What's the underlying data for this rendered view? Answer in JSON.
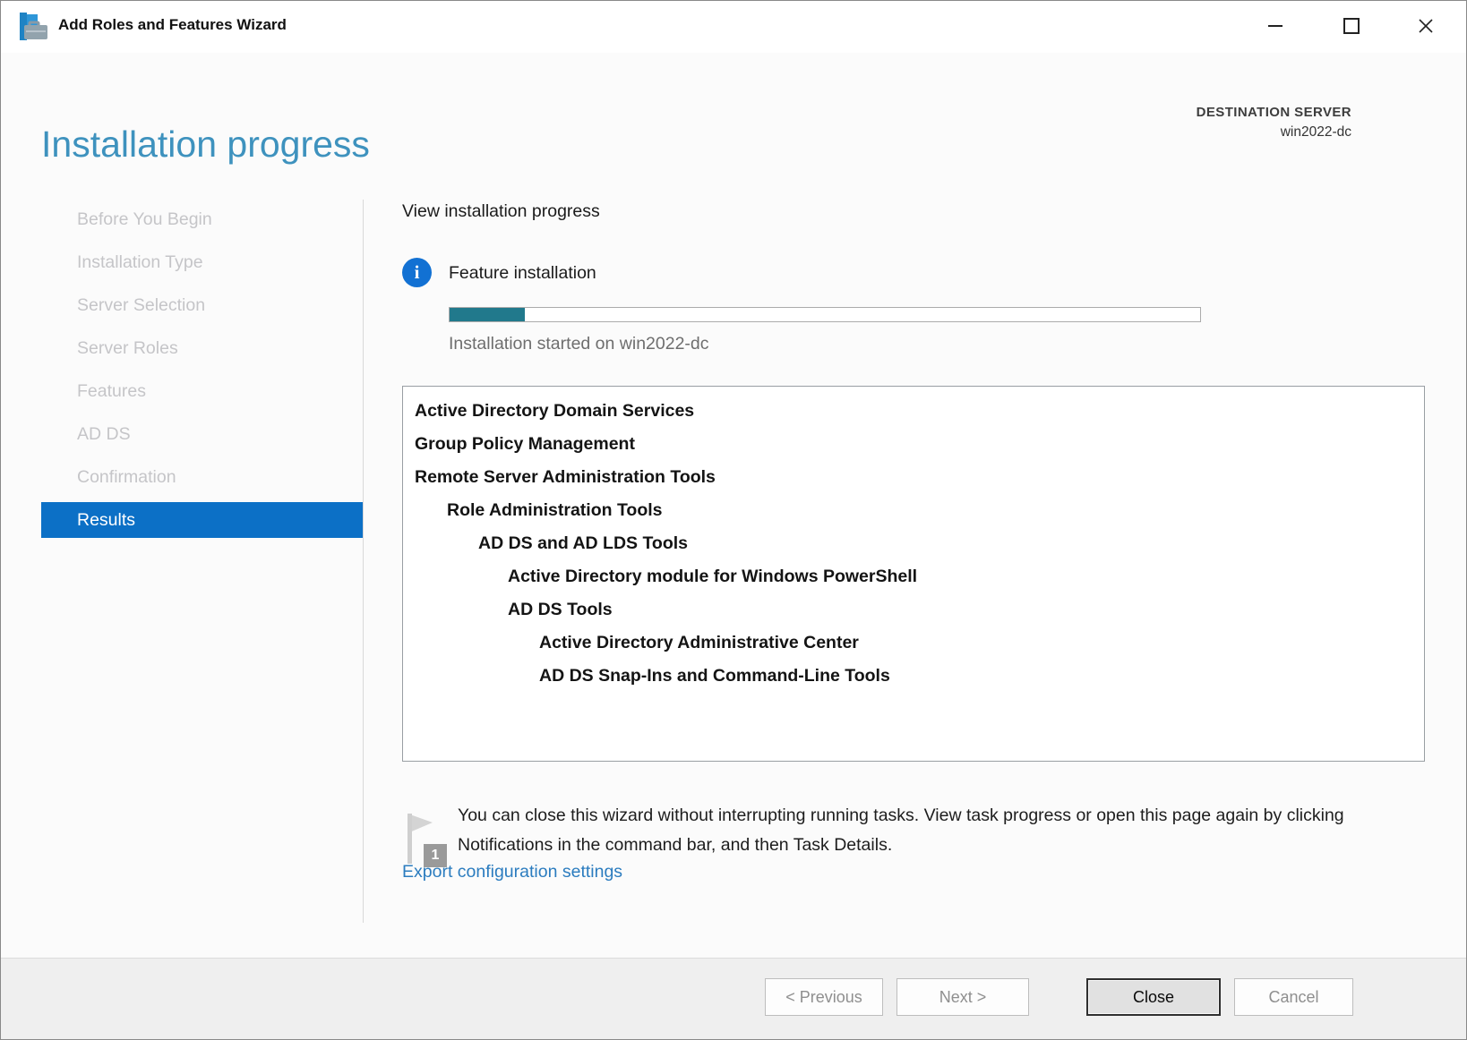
{
  "window": {
    "title": "Add Roles and Features Wizard",
    "controls": [
      "minimize",
      "maximize",
      "close"
    ]
  },
  "header": {
    "title": "Installation progress",
    "destination_label": "DESTINATION SERVER",
    "destination_server": "win2022-dc"
  },
  "sidebar": {
    "items": [
      {
        "label": "Before You Begin",
        "state": "disabled"
      },
      {
        "label": "Installation Type",
        "state": "disabled"
      },
      {
        "label": "Server Selection",
        "state": "disabled"
      },
      {
        "label": "Server Roles",
        "state": "disabled"
      },
      {
        "label": "Features",
        "state": "disabled"
      },
      {
        "label": "AD DS",
        "state": "disabled"
      },
      {
        "label": "Confirmation",
        "state": "disabled"
      },
      {
        "label": "Results",
        "state": "selected"
      }
    ]
  },
  "main": {
    "section_title": "View installation progress",
    "status": {
      "icon": "info-circle-icon",
      "title": "Feature installation",
      "progress_percent": 10,
      "detail": "Installation started on win2022-dc"
    },
    "features": [
      {
        "label": "Active Directory Domain Services",
        "indent": 0
      },
      {
        "label": "Group Policy Management",
        "indent": 0
      },
      {
        "label": "Remote Server Administration Tools",
        "indent": 0
      },
      {
        "label": "Role Administration Tools",
        "indent": 1
      },
      {
        "label": "AD DS and AD LDS Tools",
        "indent": 2
      },
      {
        "label": "Active Directory module for Windows PowerShell",
        "indent": 3
      },
      {
        "label": "AD DS Tools",
        "indent": 3
      },
      {
        "label": "Active Directory Administrative Center",
        "indent": 4
      },
      {
        "label": "AD DS Snap-Ins and Command-Line Tools",
        "indent": 4
      }
    ],
    "note": {
      "icon": "notification-flag-icon",
      "badge": "1",
      "text": "You can close this wizard without interrupting running tasks. View task progress or open this page again by clicking Notifications in the command bar, and then Task Details."
    },
    "export_link": "Export configuration settings"
  },
  "footer": {
    "buttons": [
      {
        "label": "< Previous",
        "state": "disabled"
      },
      {
        "label": "Next >",
        "state": "disabled"
      },
      {
        "label": "Close",
        "state": "default"
      },
      {
        "label": "Cancel",
        "state": "disabled"
      }
    ]
  },
  "colors": {
    "heading": "#3E92BE",
    "selected_nav": "#0C70C6",
    "info_icon": "#1271D3",
    "progress_fill": "#21798C",
    "link": "#2B7CBF",
    "footer_bg": "#EFEFEF"
  }
}
